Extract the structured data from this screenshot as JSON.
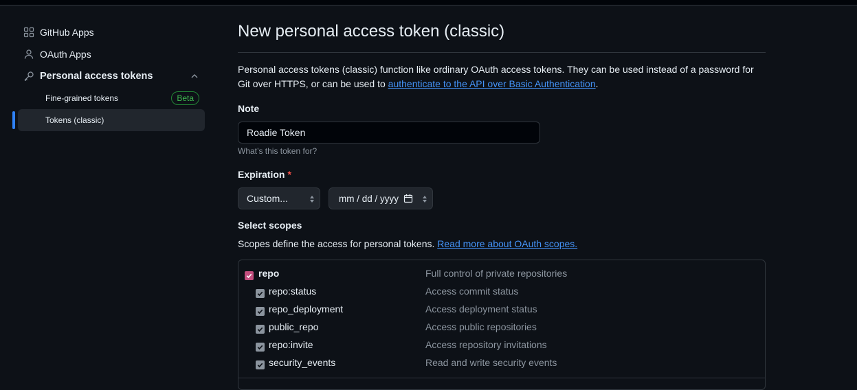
{
  "sidebar": {
    "github_apps": "GitHub Apps",
    "oauth_apps": "OAuth Apps",
    "personal_access_tokens": "Personal access tokens",
    "fine_grained": "Fine-grained tokens",
    "beta_badge": "Beta",
    "tokens_classic": "Tokens (classic)"
  },
  "page": {
    "title": "New personal access token (classic)",
    "intro_text": "Personal access tokens (classic) function like ordinary OAuth access tokens. They can be used instead of a password for Git over HTTPS, or can be used to ",
    "intro_link": "authenticate to the API over Basic Authentication",
    "intro_end": "."
  },
  "note": {
    "label": "Note",
    "value": "Roadie Token",
    "hint": "What’s this token for?"
  },
  "expiration": {
    "label": "Expiration",
    "required_mark": "*",
    "select_value": "Custom...",
    "date_placeholder": "mm / dd / yyyy"
  },
  "scopes": {
    "label": "Select scopes",
    "desc": "Scopes define the access for personal tokens. ",
    "link": "Read more about OAuth scopes.",
    "items": [
      {
        "name": "repo",
        "desc": "Full control of private repositories",
        "checked": true
      },
      {
        "name": "repo:status",
        "desc": "Access commit status",
        "checked": true
      },
      {
        "name": "repo_deployment",
        "desc": "Access deployment status",
        "checked": true
      },
      {
        "name": "public_repo",
        "desc": "Access public repositories",
        "checked": true
      },
      {
        "name": "repo:invite",
        "desc": "Access repository invitations",
        "checked": true
      },
      {
        "name": "security_events",
        "desc": "Read and write security events",
        "checked": true
      }
    ]
  },
  "colors": {
    "accent": "#2f81f7",
    "link": "#4493f8",
    "beta_green": "#3fb950",
    "checked_parent": "#c24e7e",
    "checked_child": "#8b949e"
  },
  "icons": {
    "github_apps": "apps-grid-icon",
    "oauth_apps": "person-icon",
    "tokens": "key-icon",
    "collapse": "chevron-up-icon",
    "calendar": "calendar-icon",
    "select": "sort-arrows-icon",
    "check": "checkmark-icon"
  }
}
